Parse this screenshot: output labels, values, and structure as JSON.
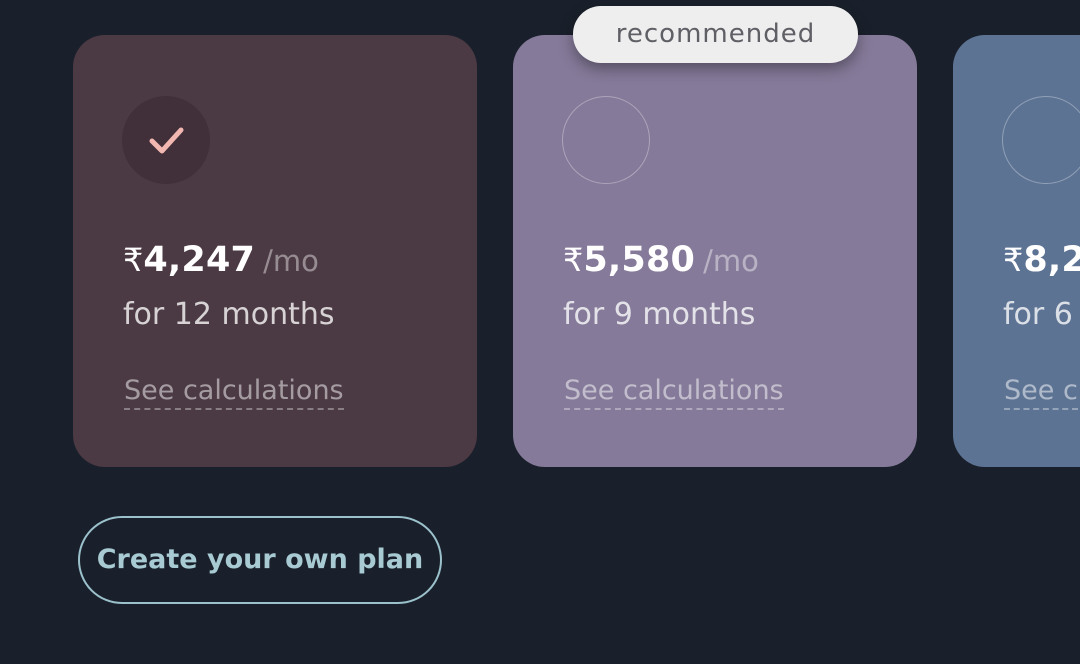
{
  "badge": {
    "recommended": "recommended"
  },
  "plans": [
    {
      "currency": "₹",
      "price": "4,247",
      "unit": "/mo",
      "duration": "for 12 months",
      "link": "See calculations",
      "selected": true,
      "color": "#4b3943"
    },
    {
      "currency": "₹",
      "price": "5,580",
      "unit": "/mo",
      "duration": "for 9 months",
      "link": "See calculations",
      "selected": false,
      "recommended": true,
      "color": "#857a99"
    },
    {
      "currency": "₹",
      "price": "8,2",
      "unit": "/mo",
      "duration": "for 6",
      "link": "See c",
      "selected": false,
      "color": "#5d7394"
    }
  ],
  "actions": {
    "create_plan": "Create your own plan"
  },
  "colors": {
    "background": "#1a202b",
    "check": "#f2b7b0",
    "outline_button": "#9bc2cc"
  },
  "icons": {
    "selected": "check-icon",
    "unselected": "radio-circle-icon"
  }
}
